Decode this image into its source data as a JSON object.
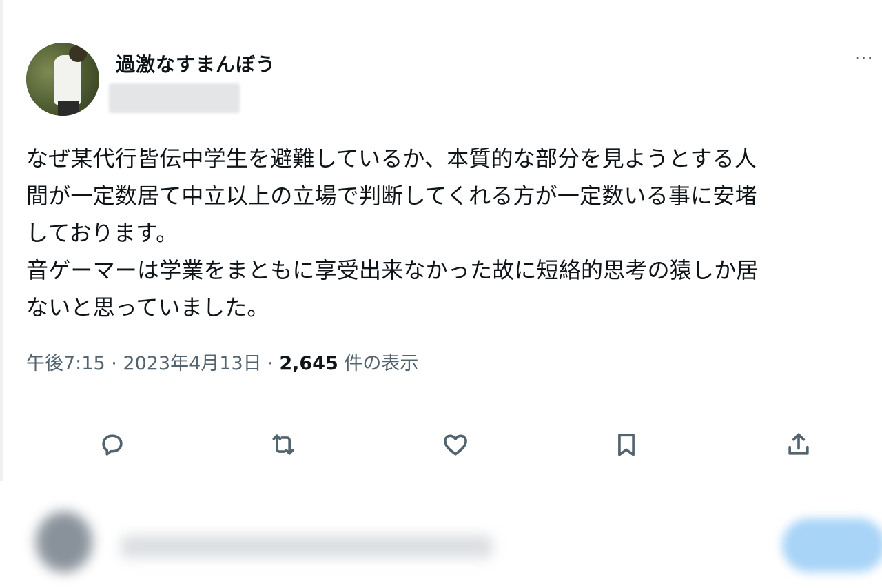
{
  "tweet": {
    "display_name": "過激なすまんぼう",
    "more_label": "···",
    "text_lines": [
      "なぜ某代行皆伝中学生を避難しているか、本質的な部分を見ようとする人",
      "間が一定数居て中立以上の立場で判断してくれる方が一定数いる事に安堵",
      "しております。",
      "音ゲーマーは学業をまともに享受出来なかった故に短絡的思考の猿しか居",
      "ないと思っていました。"
    ],
    "time": "午後7:15",
    "separator": " · ",
    "date": "2023年4月13日",
    "views_count": "2,645",
    "views_label": " 件の表示"
  },
  "actions": [
    {
      "name": "reply",
      "icon": "reply-icon"
    },
    {
      "name": "retweet",
      "icon": "retweet-icon"
    },
    {
      "name": "like",
      "icon": "heart-icon"
    },
    {
      "name": "bookmark",
      "icon": "bookmark-icon"
    },
    {
      "name": "share",
      "icon": "share-icon"
    }
  ],
  "colors": {
    "text": "#0f1419",
    "secondary": "#536471",
    "divider": "#e6e8ea",
    "reply_button": "#a8d4f7"
  }
}
